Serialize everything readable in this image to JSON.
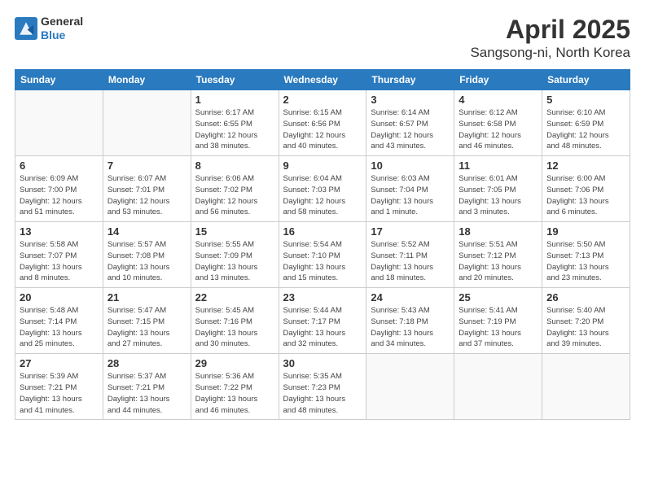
{
  "header": {
    "logo_general": "General",
    "logo_blue": "Blue",
    "month_title": "April 2025",
    "location": "Sangsong-ni, North Korea"
  },
  "weekdays": [
    "Sunday",
    "Monday",
    "Tuesday",
    "Wednesday",
    "Thursday",
    "Friday",
    "Saturday"
  ],
  "weeks": [
    [
      {
        "day": "",
        "info": ""
      },
      {
        "day": "",
        "info": ""
      },
      {
        "day": "1",
        "info": "Sunrise: 6:17 AM\nSunset: 6:55 PM\nDaylight: 12 hours\nand 38 minutes."
      },
      {
        "day": "2",
        "info": "Sunrise: 6:15 AM\nSunset: 6:56 PM\nDaylight: 12 hours\nand 40 minutes."
      },
      {
        "day": "3",
        "info": "Sunrise: 6:14 AM\nSunset: 6:57 PM\nDaylight: 12 hours\nand 43 minutes."
      },
      {
        "day": "4",
        "info": "Sunrise: 6:12 AM\nSunset: 6:58 PM\nDaylight: 12 hours\nand 46 minutes."
      },
      {
        "day": "5",
        "info": "Sunrise: 6:10 AM\nSunset: 6:59 PM\nDaylight: 12 hours\nand 48 minutes."
      }
    ],
    [
      {
        "day": "6",
        "info": "Sunrise: 6:09 AM\nSunset: 7:00 PM\nDaylight: 12 hours\nand 51 minutes."
      },
      {
        "day": "7",
        "info": "Sunrise: 6:07 AM\nSunset: 7:01 PM\nDaylight: 12 hours\nand 53 minutes."
      },
      {
        "day": "8",
        "info": "Sunrise: 6:06 AM\nSunset: 7:02 PM\nDaylight: 12 hours\nand 56 minutes."
      },
      {
        "day": "9",
        "info": "Sunrise: 6:04 AM\nSunset: 7:03 PM\nDaylight: 12 hours\nand 58 minutes."
      },
      {
        "day": "10",
        "info": "Sunrise: 6:03 AM\nSunset: 7:04 PM\nDaylight: 13 hours\nand 1 minute."
      },
      {
        "day": "11",
        "info": "Sunrise: 6:01 AM\nSunset: 7:05 PM\nDaylight: 13 hours\nand 3 minutes."
      },
      {
        "day": "12",
        "info": "Sunrise: 6:00 AM\nSunset: 7:06 PM\nDaylight: 13 hours\nand 6 minutes."
      }
    ],
    [
      {
        "day": "13",
        "info": "Sunrise: 5:58 AM\nSunset: 7:07 PM\nDaylight: 13 hours\nand 8 minutes."
      },
      {
        "day": "14",
        "info": "Sunrise: 5:57 AM\nSunset: 7:08 PM\nDaylight: 13 hours\nand 10 minutes."
      },
      {
        "day": "15",
        "info": "Sunrise: 5:55 AM\nSunset: 7:09 PM\nDaylight: 13 hours\nand 13 minutes."
      },
      {
        "day": "16",
        "info": "Sunrise: 5:54 AM\nSunset: 7:10 PM\nDaylight: 13 hours\nand 15 minutes."
      },
      {
        "day": "17",
        "info": "Sunrise: 5:52 AM\nSunset: 7:11 PM\nDaylight: 13 hours\nand 18 minutes."
      },
      {
        "day": "18",
        "info": "Sunrise: 5:51 AM\nSunset: 7:12 PM\nDaylight: 13 hours\nand 20 minutes."
      },
      {
        "day": "19",
        "info": "Sunrise: 5:50 AM\nSunset: 7:13 PM\nDaylight: 13 hours\nand 23 minutes."
      }
    ],
    [
      {
        "day": "20",
        "info": "Sunrise: 5:48 AM\nSunset: 7:14 PM\nDaylight: 13 hours\nand 25 minutes."
      },
      {
        "day": "21",
        "info": "Sunrise: 5:47 AM\nSunset: 7:15 PM\nDaylight: 13 hours\nand 27 minutes."
      },
      {
        "day": "22",
        "info": "Sunrise: 5:45 AM\nSunset: 7:16 PM\nDaylight: 13 hours\nand 30 minutes."
      },
      {
        "day": "23",
        "info": "Sunrise: 5:44 AM\nSunset: 7:17 PM\nDaylight: 13 hours\nand 32 minutes."
      },
      {
        "day": "24",
        "info": "Sunrise: 5:43 AM\nSunset: 7:18 PM\nDaylight: 13 hours\nand 34 minutes."
      },
      {
        "day": "25",
        "info": "Sunrise: 5:41 AM\nSunset: 7:19 PM\nDaylight: 13 hours\nand 37 minutes."
      },
      {
        "day": "26",
        "info": "Sunrise: 5:40 AM\nSunset: 7:20 PM\nDaylight: 13 hours\nand 39 minutes."
      }
    ],
    [
      {
        "day": "27",
        "info": "Sunrise: 5:39 AM\nSunset: 7:21 PM\nDaylight: 13 hours\nand 41 minutes."
      },
      {
        "day": "28",
        "info": "Sunrise: 5:37 AM\nSunset: 7:21 PM\nDaylight: 13 hours\nand 44 minutes."
      },
      {
        "day": "29",
        "info": "Sunrise: 5:36 AM\nSunset: 7:22 PM\nDaylight: 13 hours\nand 46 minutes."
      },
      {
        "day": "30",
        "info": "Sunrise: 5:35 AM\nSunset: 7:23 PM\nDaylight: 13 hours\nand 48 minutes."
      },
      {
        "day": "",
        "info": ""
      },
      {
        "day": "",
        "info": ""
      },
      {
        "day": "",
        "info": ""
      }
    ]
  ]
}
